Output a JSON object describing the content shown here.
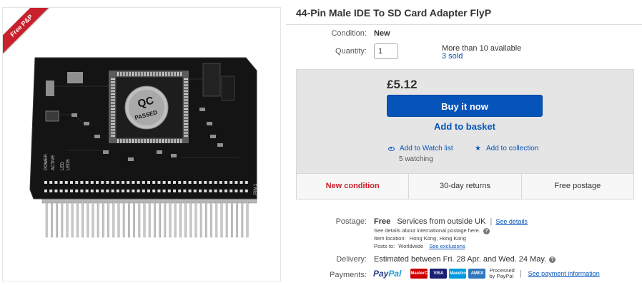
{
  "image": {
    "ribbon": "Free P&P",
    "chip_label_top": "QC",
    "chip_label_bottom": "PASSED",
    "board_labels": {
      "power": "POWER",
      "active": "ACTIVE",
      "led": "LED",
      "leds": "LEDS",
      "pin1": "PIN 1"
    }
  },
  "title": "44-Pin Male IDE To SD Card Adapter FlyP",
  "condition": {
    "label": "Condition:",
    "value": "New"
  },
  "quantity": {
    "label": "Quantity:",
    "value": "1",
    "available": "More than 10 available",
    "sold": "3 sold"
  },
  "buy": {
    "price": "£5.12",
    "buy_now": "Buy it now",
    "add_to_basket": "Add to basket",
    "watch_list": "Add to Watch list",
    "watching": "5 watching",
    "collection": "Add to collection"
  },
  "features": [
    "New condition",
    "30-day returns",
    "Free postage"
  ],
  "postage": {
    "label": "Postage:",
    "value": "Free",
    "service": "Services from outside UK",
    "sep": "|",
    "see_details": "See details",
    "intl_note": "See details about international postage here.",
    "item_location_label": "Item location:",
    "item_location": "Hong Kong, Hong Kong",
    "posts_to_label": "Posts to:",
    "posts_to": "Worldwide",
    "see_exclusions": "See exclusions"
  },
  "delivery": {
    "label": "Delivery:",
    "value": "Estimated between Fri. 28 Apr. and Wed. 24 May."
  },
  "payments": {
    "label": "Payments:",
    "paypal_a": "Pay",
    "paypal_b": "Pal",
    "cards": [
      "MasterCard",
      "VISA",
      "Maestro",
      "AMEX"
    ],
    "processed_a": "Processed",
    "processed_b": "by PayPal",
    "sep": "|",
    "see_info": "See payment information"
  },
  "colors": {
    "link": "#0654ba",
    "button": "#0654ba",
    "ribbon": "#c8202c",
    "new_condition": "#c8202c",
    "mastercard": "#cc0000",
    "visa": "#1a1f71",
    "maestro": "#0099df",
    "amex": "#2e77bc"
  }
}
